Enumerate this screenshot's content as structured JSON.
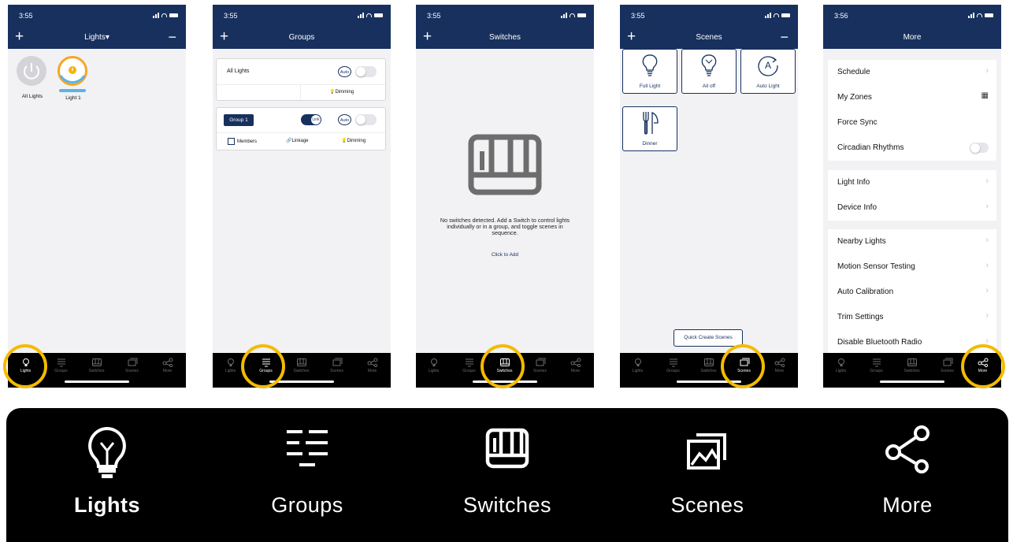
{
  "colors": {
    "nav": "#17305e",
    "highlight": "#f4bb00",
    "accent_orange": "#f5a623",
    "accent_blue": "#5ab4e6"
  },
  "screens": [
    {
      "status_time": "3:55",
      "nav_title": "Lights▾",
      "content": {
        "lights": [
          {
            "name": "All Lights",
            "state": "off"
          },
          {
            "name": "Light 1",
            "state": "on"
          }
        ]
      },
      "active_tab": "Lights"
    },
    {
      "status_time": "3:55",
      "nav_title": "Groups",
      "content": {
        "all_lights_card": {
          "label": "All Lights",
          "auto_label": "Auto",
          "dimming_label": "Dimming"
        },
        "group_card": {
          "label": "Group 1",
          "link_label": "Link",
          "auto_label": "Auto",
          "members_label": "Members",
          "linkage_label": "Linkage",
          "dimming_label": "Dimming"
        }
      },
      "active_tab": "Groups"
    },
    {
      "status_time": "3:55",
      "nav_title": "Switches",
      "content": {
        "message": "No switches detected. Add a Switch to control lights individually or in a group, and toggle scenes in sequence.",
        "add_link": "Click to Add"
      },
      "active_tab": "Switches"
    },
    {
      "status_time": "3:55",
      "nav_title": "Scenes",
      "content": {
        "scenes": [
          "Full Light",
          "All off",
          "Auto Light",
          "Dinner"
        ],
        "quick_create": "Quick Create Scenes"
      },
      "active_tab": "Scenes"
    },
    {
      "status_time": "3:56",
      "nav_title": "More",
      "content": {
        "menu_groups": [
          [
            "Schedule",
            "My Zones",
            "Force Sync",
            "Circadian Rhythms"
          ],
          [
            "Light Info",
            "Device Info"
          ],
          [
            "Nearby Lights",
            "Motion Sensor Testing",
            "Auto Calibration",
            "Trim Settings",
            "Disable Bluetooth Radio"
          ]
        ]
      },
      "active_tab": "More"
    }
  ],
  "tabs": [
    "Lights",
    "Groups",
    "Switches",
    "Scenes",
    "More"
  ],
  "big_tabbar": {
    "tabs": [
      {
        "label": "Lights",
        "icon": "bulb-icon"
      },
      {
        "label": "Groups",
        "icon": "groups-list-icon"
      },
      {
        "label": "Switches",
        "icon": "switch-panel-icon"
      },
      {
        "label": "Scenes",
        "icon": "scenes-images-icon"
      },
      {
        "label": "More",
        "icon": "share-nodes-icon"
      }
    ]
  }
}
